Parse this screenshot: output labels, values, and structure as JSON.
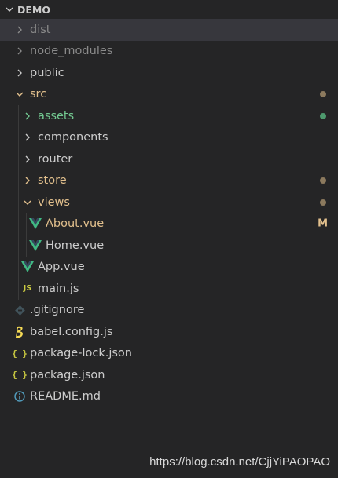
{
  "explorer": {
    "title": "DEMO",
    "colors": {
      "background": "#252526",
      "selected": "#37373d",
      "modified": "#e2c08d",
      "untracked": "#73c991",
      "dimmed": "#8a8a8a",
      "vue": "#41b883"
    },
    "items": [
      {
        "label": "dist",
        "icon": "chevron-right-icon"
      },
      {
        "label": "node_modules",
        "icon": "chevron-right-icon"
      },
      {
        "label": "public",
        "icon": "chevron-right-icon"
      },
      {
        "label": "src",
        "icon": "chevron-down-icon"
      },
      {
        "label": "assets",
        "icon": "chevron-right-icon"
      },
      {
        "label": "components",
        "icon": "chevron-right-icon"
      },
      {
        "label": "router",
        "icon": "chevron-right-icon"
      },
      {
        "label": "store",
        "icon": "chevron-right-icon"
      },
      {
        "label": "views",
        "icon": "chevron-down-icon"
      },
      {
        "label": "About.vue",
        "icon": "vue-icon",
        "badge": "M"
      },
      {
        "label": "Home.vue",
        "icon": "vue-icon"
      },
      {
        "label": "App.vue",
        "icon": "vue-icon"
      },
      {
        "label": "main.js",
        "icon": "js-icon",
        "icon_text": "JS"
      },
      {
        "label": ".gitignore",
        "icon": "git-icon"
      },
      {
        "label": "babel.config.js",
        "icon": "babel-icon"
      },
      {
        "label": "package-lock.json",
        "icon": "json-icon",
        "icon_text": "{ }"
      },
      {
        "label": "package.json",
        "icon": "json-icon",
        "icon_text": "{ }"
      },
      {
        "label": "README.md",
        "icon": "info-icon"
      }
    ]
  },
  "watermark": "https://blog.csdn.net/CjjYiPAOPAO"
}
